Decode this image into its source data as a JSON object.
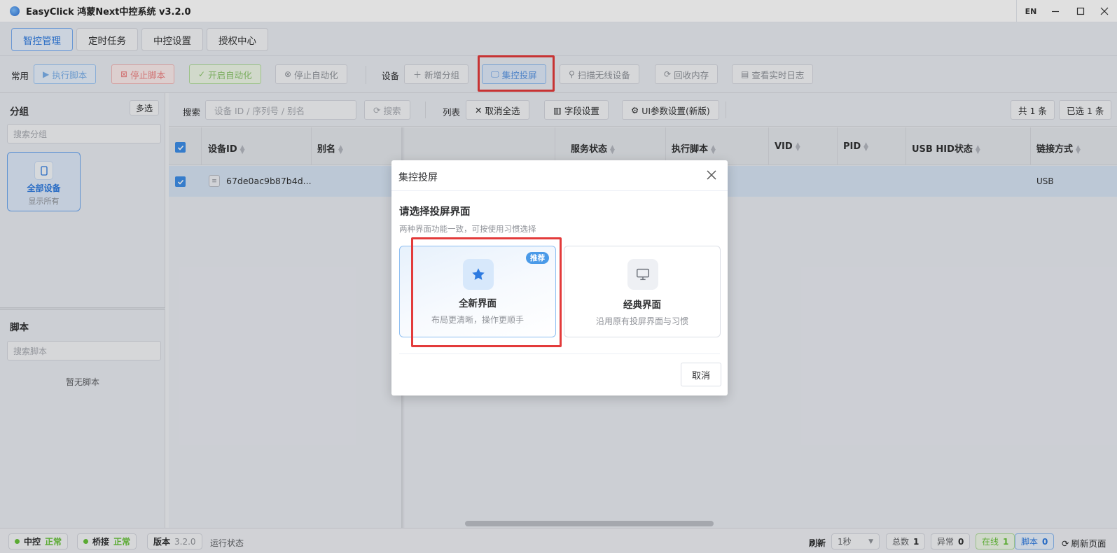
{
  "window": {
    "title": "EasyClick 鸿蒙Next中控系统 v3.2.0",
    "lang_button": "EN",
    "controls": [
      "minimize-icon",
      "maximize-icon",
      "close-icon"
    ]
  },
  "nav_tabs": [
    {
      "label": "智控管理",
      "active": true
    },
    {
      "label": "定时任务",
      "active": false
    },
    {
      "label": "中控设置",
      "active": false
    },
    {
      "label": "授权中心",
      "active": false
    }
  ],
  "toolbar": {
    "common_label": "常用",
    "run_script": "执行脚本",
    "stop_script": "停止脚本",
    "start_auto": "开启自动化",
    "stop_auto": "停止自动化",
    "device_label": "设备",
    "add_group": "新增分组",
    "screen_cast": "集控投屏",
    "scan_wireless": "扫描无线设备",
    "recycle_memory": "回收内存",
    "view_log": "查看实时日志"
  },
  "sidebar": {
    "group_title": "分组",
    "multi_select": "多选",
    "group_search_placeholder": "搜索分组",
    "group_card": {
      "name": "全部设备",
      "sub": "显示所有"
    },
    "script_title": "脚本",
    "script_search_placeholder": "搜索脚本",
    "no_script": "暂无脚本"
  },
  "search_row": {
    "search_label": "搜索",
    "search_placeholder": "设备 ID / 序列号 / 别名",
    "search_button": "搜索",
    "list_label": "列表",
    "cancel_select_all": "取消全选",
    "field_settings": "字段设置",
    "ui_settings": "UI参数设置(新版)",
    "total": "共 1 条",
    "selected": "已选 1 条"
  },
  "table": {
    "columns": [
      "设备ID",
      "别名",
      "服务状态",
      "执行脚本",
      "VID",
      "PID",
      "USB HID状态",
      "链接方式"
    ],
    "rows": [
      {
        "device_id": "67de0ac9b87b4d...",
        "alias": "",
        "link": "USB",
        "checked": true
      }
    ]
  },
  "statusbar": {
    "center_label": "中控",
    "center_status": "正常",
    "bridge_label": "桥接",
    "bridge_status": "正常",
    "version_label": "版本",
    "version": "3.2.0",
    "run_state": "运行状态",
    "refresh_label": "刷新",
    "refresh_interval": "1秒",
    "total_label": "总数",
    "total": "1",
    "abnormal_label": "异常",
    "abnormal": "0",
    "online_label": "在线",
    "online": "1",
    "script_label": "脚本",
    "script": "0",
    "refresh_page": "刷新页面"
  },
  "modal": {
    "title": "集控投屏",
    "prompt": "请选择投屏界面",
    "hint": "两种界面功能一致，可按使用习惯选择",
    "options": [
      {
        "name": "全新界面",
        "desc": "布局更清晰，操作更顺手",
        "badge": "推荐",
        "selected": true,
        "icon": "star-icon"
      },
      {
        "name": "经典界面",
        "desc": "沿用原有投屏界面与习惯",
        "selected": false,
        "icon": "monitor-icon"
      }
    ],
    "cancel": "取消"
  },
  "colors": {
    "accent": "#2d7ae0",
    "highlight_box": "#e33b3b",
    "success": "#67c23a"
  }
}
